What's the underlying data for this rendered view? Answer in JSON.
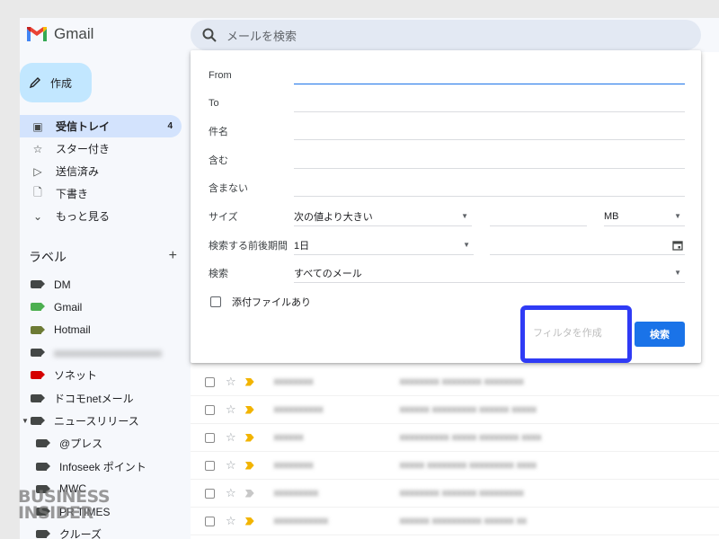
{
  "app": {
    "name": "Gmail"
  },
  "search": {
    "placeholder": "メールを検索"
  },
  "compose": {
    "label": "作成"
  },
  "nav": {
    "items": [
      {
        "label": "受信トレイ",
        "count": "4",
        "icon": "inbox-icon"
      },
      {
        "label": "スター付き",
        "icon": "star-icon"
      },
      {
        "label": "送信済み",
        "icon": "send-icon"
      },
      {
        "label": "下書き",
        "icon": "draft-icon"
      },
      {
        "label": "もっと見る",
        "icon": "chevron-down-icon"
      }
    ]
  },
  "labels": {
    "heading": "ラベル",
    "add": "+",
    "items": [
      {
        "label": "DM",
        "color": "#444746"
      },
      {
        "label": "Gmail",
        "color": "#4caf50"
      },
      {
        "label": "Hotmail",
        "color": "#6d7b35"
      },
      {
        "label": "",
        "color": "#444746"
      },
      {
        "label": "ソネット",
        "color": "#d50000"
      },
      {
        "label": "ドコモnetメール",
        "color": "#444746"
      },
      {
        "label": "ニュースリリース",
        "color": "#444746"
      },
      {
        "label": "@プレス",
        "color": "#444746"
      },
      {
        "label": "Infoseek ポイント",
        "color": "#444746"
      },
      {
        "label": "MWC",
        "color": "#444746"
      },
      {
        "label": "PR TIMES",
        "color": "#444746"
      },
      {
        "label": "クルーズ",
        "color": "#444746"
      }
    ]
  },
  "filter": {
    "fields": [
      {
        "label": "From",
        "value": ""
      },
      {
        "label": "To",
        "value": ""
      },
      {
        "label": "件名",
        "value": ""
      },
      {
        "label": "含む",
        "value": ""
      },
      {
        "label": "含まない",
        "value": ""
      }
    ],
    "size_label": "サイズ",
    "size_op": "次の値より大きい",
    "size_unit": "MB",
    "date_label": "検索する前後期間",
    "date_value": "1日",
    "search_label": "検索",
    "search_value": "すべてのメール",
    "attachment_label": "添付ファイルあり",
    "create_filter": "フィルタを作成",
    "search_button": "検索"
  },
  "watermark": {
    "line1": "BUSINESS",
    "line2": "INSIDER"
  },
  "colors": {
    "accent": "#1a73e8",
    "highlight": "#2f3bf5",
    "active_nav": "#d3e3fd",
    "compose": "#c2e7ff"
  }
}
